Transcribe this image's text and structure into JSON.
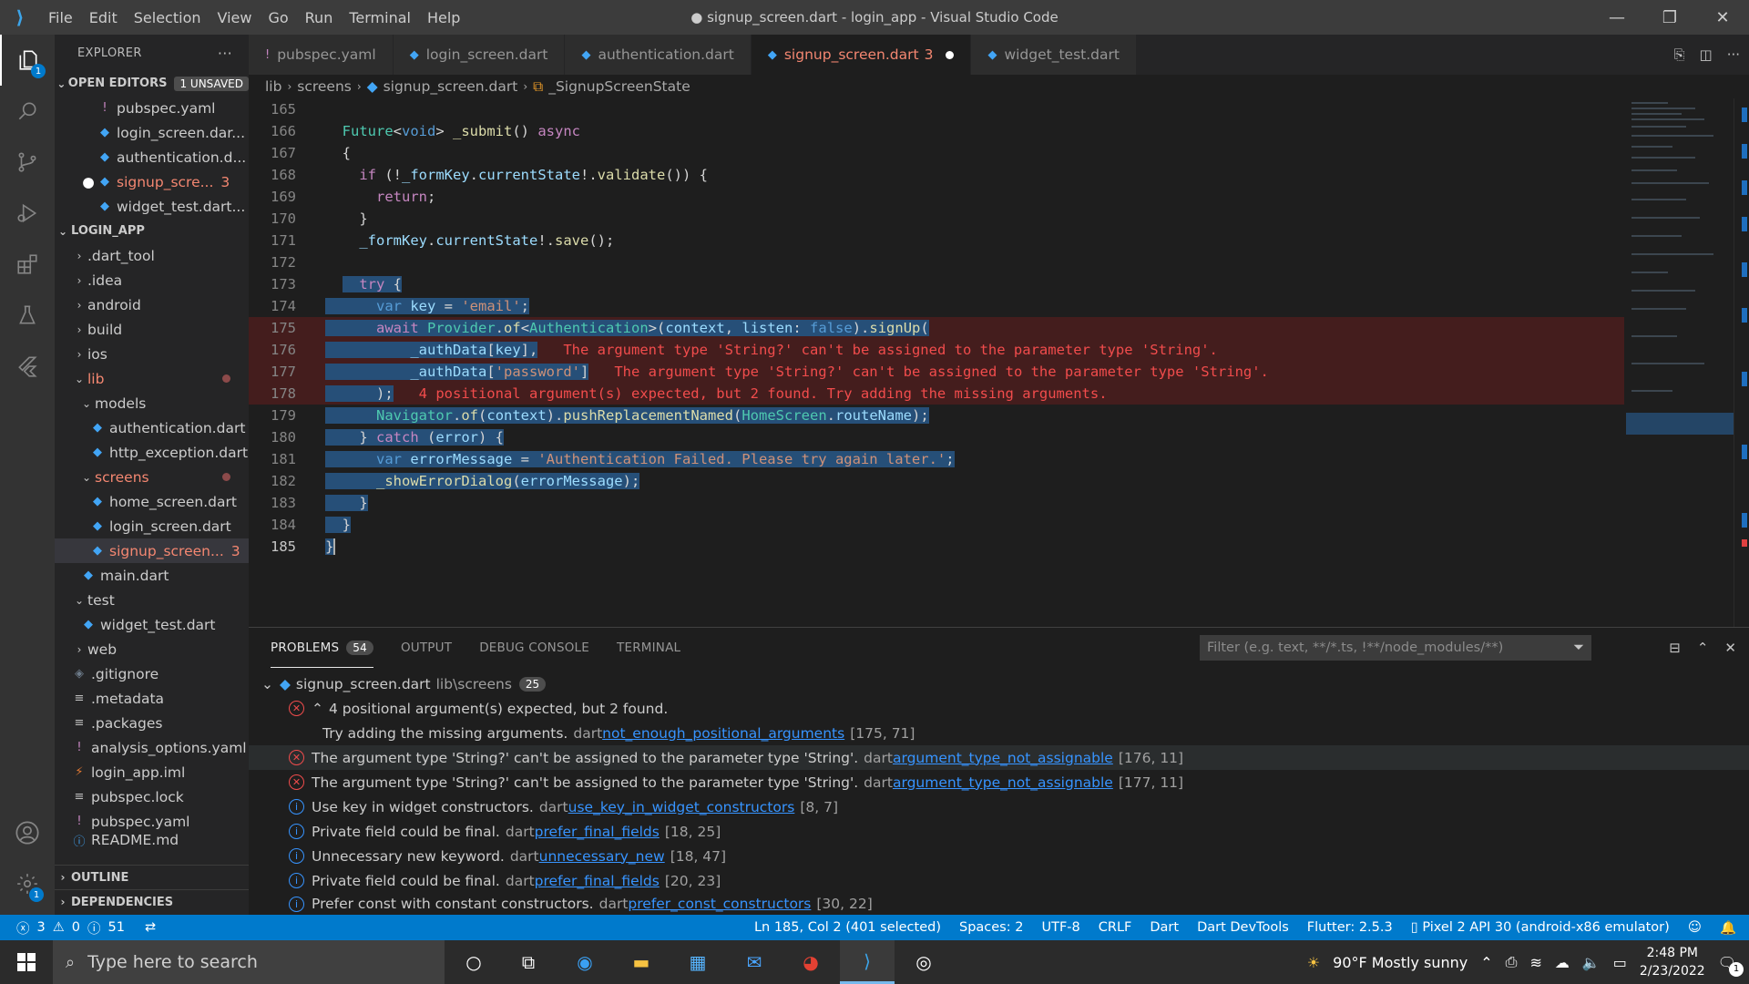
{
  "titlebar": {
    "menu": [
      "File",
      "Edit",
      "Selection",
      "View",
      "Go",
      "Run",
      "Terminal",
      "Help"
    ],
    "title": "● signup_screen.dart - login_app - Visual Studio Code",
    "minimize": "—",
    "restore": "❐",
    "close": "✕"
  },
  "activity": {
    "explorer_badge": "1",
    "settings_badge": "1"
  },
  "sidebar": {
    "title": "EXPLORER",
    "more": "···",
    "open_editors": {
      "label": "OPEN EDITORS",
      "badge": "1 UNSAVED"
    },
    "open_files": [
      {
        "icon": "!",
        "name": "pubspec.yaml"
      },
      {
        "icon": "◆",
        "name": "login_screen.dar..."
      },
      {
        "icon": "◆",
        "name": "authentication.d..."
      },
      {
        "icon": "◆",
        "name": "signup_scre...",
        "count": "3"
      },
      {
        "icon": "◆",
        "name": "widget_test.dart..."
      }
    ],
    "project": "LOGIN_APP",
    "tree": [
      {
        "chev": "›",
        "name": ".dart_tool"
      },
      {
        "chev": "›",
        "name": ".idea"
      },
      {
        "chev": "›",
        "name": "android"
      },
      {
        "chev": "›",
        "name": "build"
      },
      {
        "chev": "›",
        "name": "ios"
      },
      {
        "chev": "⌄",
        "name": "lib"
      },
      {
        "chev": "⌄",
        "name": "models"
      },
      {
        "icon": "◆",
        "name": "authentication.dart"
      },
      {
        "icon": "◆",
        "name": "http_exception.dart"
      },
      {
        "chev": "⌄",
        "name": "screens"
      },
      {
        "icon": "◆",
        "name": "home_screen.dart"
      },
      {
        "icon": "◆",
        "name": "login_screen.dart"
      },
      {
        "icon": "◆",
        "name": "signup_screen...",
        "count": "3"
      },
      {
        "icon": "◆",
        "name": "main.dart"
      },
      {
        "chev": "⌄",
        "name": "test"
      },
      {
        "icon": "◆",
        "name": "widget_test.dart"
      },
      {
        "chev": "›",
        "name": "web"
      },
      {
        "icon": "◈",
        "name": ".gitignore"
      },
      {
        "icon": "≡",
        "name": ".metadata"
      },
      {
        "icon": "≡",
        "name": ".packages"
      },
      {
        "icon": "!",
        "name": "analysis_options.yaml"
      },
      {
        "icon": "⚡",
        "name": "login_app.iml"
      },
      {
        "icon": "≡",
        "name": "pubspec.lock"
      },
      {
        "icon": "!",
        "name": "pubspec.yaml"
      },
      {
        "icon": "ⓘ",
        "name": "README.md"
      }
    ],
    "outline": "OUTLINE",
    "dependencies": "DEPENDENCIES"
  },
  "tabs": [
    {
      "icon": "!",
      "name": "pubspec.yaml"
    },
    {
      "icon": "◆",
      "name": "login_screen.dart"
    },
    {
      "icon": "◆",
      "name": "authentication.dart"
    },
    {
      "icon": "◆",
      "name": "signup_screen.dart",
      "count": "3"
    },
    {
      "icon": "◆",
      "name": "widget_test.dart"
    }
  ],
  "breadcrumb": {
    "parts": [
      "lib",
      "screens",
      "signup_screen.dart",
      "_SignupScreenState"
    ]
  },
  "editor": {
    "line_numbers": [
      "165",
      "166",
      "167",
      "168",
      "169",
      "170",
      "171",
      "172",
      "173",
      "174",
      "175",
      "176",
      "177",
      "178",
      "179",
      "180",
      "181",
      "182",
      "183",
      "184",
      "185"
    ],
    "diagnostics": {
      "l176": "The argument type 'String?' can't be assigned to the parameter type 'String'.",
      "l177": "The argument type 'String?' can't be assigned to the parameter type 'String'.",
      "l178": "4 positional argument(s) expected, but 2 found. Try adding the missing arguments."
    }
  },
  "panel": {
    "tabs": [
      "PROBLEMS",
      "OUTPUT",
      "DEBUG CONSOLE",
      "TERMINAL"
    ],
    "problems_count": "54",
    "filter_placeholder": "Filter (e.g. text, **/*.ts, !**/node_modules/**)",
    "file_group": {
      "name": "signup_screen.dart",
      "path": "lib\\screens",
      "count": "25"
    },
    "problems": [
      {
        "kind": "error",
        "msg": "4 positional argument(s) expected, but 2 found.",
        "src": "",
        "code": "",
        "pos": ""
      },
      {
        "kind": "none",
        "msg": "Try adding the missing arguments.",
        "src": "dart",
        "code": "not_enough_positional_arguments",
        "pos": "[175, 71]"
      },
      {
        "kind": "error",
        "msg": "The argument type 'String?' can't be assigned to the parameter type 'String'.",
        "src": "dart",
        "code": "argument_type_not_assignable",
        "pos": "[176, 11]"
      },
      {
        "kind": "error",
        "msg": "The argument type 'String?' can't be assigned to the parameter type 'String'.",
        "src": "dart",
        "code": "argument_type_not_assignable",
        "pos": "[177, 11]"
      },
      {
        "kind": "info",
        "msg": "Use key in widget constructors.",
        "src": "dart",
        "code": "use_key_in_widget_constructors",
        "pos": "[8, 7]"
      },
      {
        "kind": "info",
        "msg": "Private field could be final.",
        "src": "dart",
        "code": "prefer_final_fields",
        "pos": "[18, 25]"
      },
      {
        "kind": "info",
        "msg": "Unnecessary new keyword.",
        "src": "dart",
        "code": "unnecessary_new",
        "pos": "[18, 47]"
      },
      {
        "kind": "info",
        "msg": "Private field could be final.",
        "src": "dart",
        "code": "prefer_final_fields",
        "pos": "[20, 23]"
      },
      {
        "kind": "info",
        "msg": "Prefer const with constant constructors.",
        "src": "dart",
        "code": "prefer_const_constructors",
        "pos": "[30, 22]"
      }
    ]
  },
  "statusbar": {
    "errors": "3",
    "warnings": "0",
    "infos": "51",
    "cursor": "Ln 185, Col 2 (401 selected)",
    "spaces": "Spaces: 2",
    "encoding": "UTF-8",
    "eol": "CRLF",
    "language": "Dart",
    "devtools": "Dart DevTools",
    "flutter": "Flutter: 2.5.3",
    "device": "Pixel 2 API 30 (android-x86 emulator)"
  },
  "taskbar": {
    "search_placeholder": "Type here to search",
    "weather": "90°F  Mostly sunny",
    "time": "2:48 PM",
    "date": "2/23/2022",
    "notif_count": "1"
  }
}
